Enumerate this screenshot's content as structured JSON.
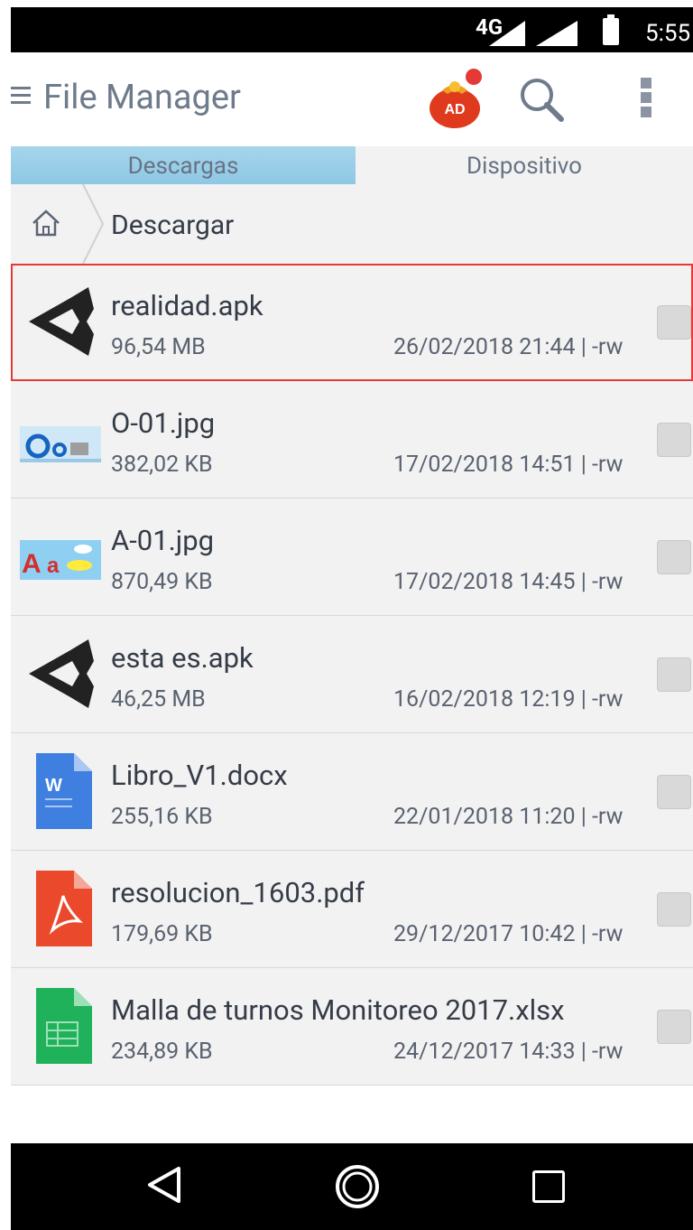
{
  "status_bar": {
    "network": "4G",
    "time": "5:55"
  },
  "app_bar": {
    "title": "File Manager",
    "ad_badge": "AD"
  },
  "tabs": [
    {
      "label": "Descargas",
      "active": true
    },
    {
      "label": "Dispositivo",
      "active": false
    }
  ],
  "path": {
    "current": "Descargar"
  },
  "files": [
    {
      "name": "realidad.apk",
      "size": "96,54 MB",
      "date": "26/02/2018 21:44 | -rw",
      "icon": "unity-icon",
      "selected": true
    },
    {
      "name": "O-01.jpg",
      "size": "382,02 KB",
      "date": "17/02/2018 14:51 | -rw",
      "icon": "image-thumbnail-o"
    },
    {
      "name": "A-01.jpg",
      "size": "870,49 KB",
      "date": "17/02/2018 14:45 | -rw",
      "icon": "image-thumbnail-a"
    },
    {
      "name": "esta es.apk",
      "size": "46,25 MB",
      "date": "16/02/2018 12:19 | -rw",
      "icon": "unity-icon"
    },
    {
      "name": "Libro_V1.docx",
      "size": "255,16 KB",
      "date": "22/01/2018 11:20 | -rw",
      "icon": "docx-icon"
    },
    {
      "name": "resolucion_1603.pdf",
      "size": "179,69 KB",
      "date": "29/12/2017 10:42 | -rw",
      "icon": "pdf-icon"
    },
    {
      "name": "Malla de turnos Monitoreo 2017.xlsx",
      "size": "234,89 KB",
      "date": "24/12/2017 14:33 | -rw",
      "icon": "xlsx-icon"
    }
  ],
  "colors": {
    "tab_active": "#9ccfe8",
    "title": "#6e7b8c",
    "selection_border": "#e53935",
    "row_bg": "#f2f2f2"
  }
}
